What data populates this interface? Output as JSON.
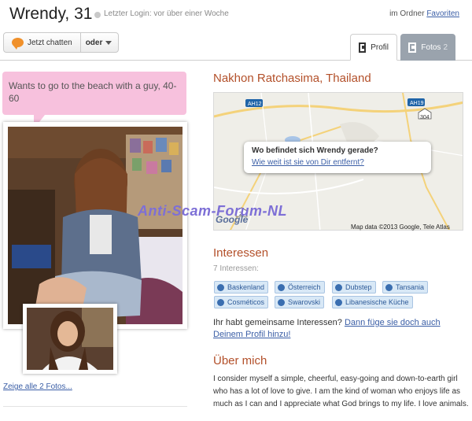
{
  "header": {
    "name_age": "Wrendy, 31",
    "last_login": "Letzter Login: vor über einer Woche",
    "folder_prefix": "im Ordner",
    "folder_link": "Favoriten"
  },
  "actions": {
    "chat_label": "Jetzt chatten",
    "oder_label": "oder"
  },
  "tabs": {
    "profil": "Profil",
    "fotos": "Fotos",
    "fotos_count": "2"
  },
  "profile": {
    "status_text": "Wants to go to the beach with a guy, 40-60",
    "all_photos_link": "Zeige alle 2 Fotos..."
  },
  "location": {
    "city": "Nakhon Ratchasima, Thailand",
    "map_question": "Wo befindet sich Wrendy gerade?",
    "map_link": "Wie weit ist sie von Dir entfernt?",
    "map_copyright": "Map data ©2013 Google, Tele Atlas",
    "map_logo": "Google",
    "map_labels": [
      "AH12",
      "AH19",
      "304",
      "2"
    ]
  },
  "watermark": "Anti-Scam-Forum-NL",
  "interests": {
    "heading": "Interessen",
    "count": "7 Interessen:",
    "tags": [
      {
        "label": "Baskenland",
        "icon": "globe-icon"
      },
      {
        "label": "Österreich",
        "icon": "globe-icon"
      },
      {
        "label": "Dubstep",
        "icon": "music-icon"
      },
      {
        "label": "Tansania",
        "icon": "globe-icon"
      },
      {
        "label": "Cosméticos",
        "icon": "clock-icon"
      },
      {
        "label": "Swarovski",
        "icon": "clock-icon"
      },
      {
        "label": "Libanesische Küche",
        "icon": "food-icon"
      }
    ],
    "common_question": "Ihr habt gemeinsame Interessen?",
    "common_link": "Dann füge sie doch auch Deinem Profil hinzu!"
  },
  "about": {
    "heading": "Über mich",
    "text": "I consider myself a simple, cheerful, easy-going and down-to-earth girl who has a lot of love to give. I am the kind of woman who enjoys life as much as I can and I appreciate what God brings to my life. I love animals."
  },
  "colors": {
    "accent_heading": "#b3502a",
    "link": "#3a5ea6",
    "bubble_pink": "#f7c1dd",
    "tag_bg": "#d8e8f6",
    "tab_inactive": "#9aa3ad"
  }
}
